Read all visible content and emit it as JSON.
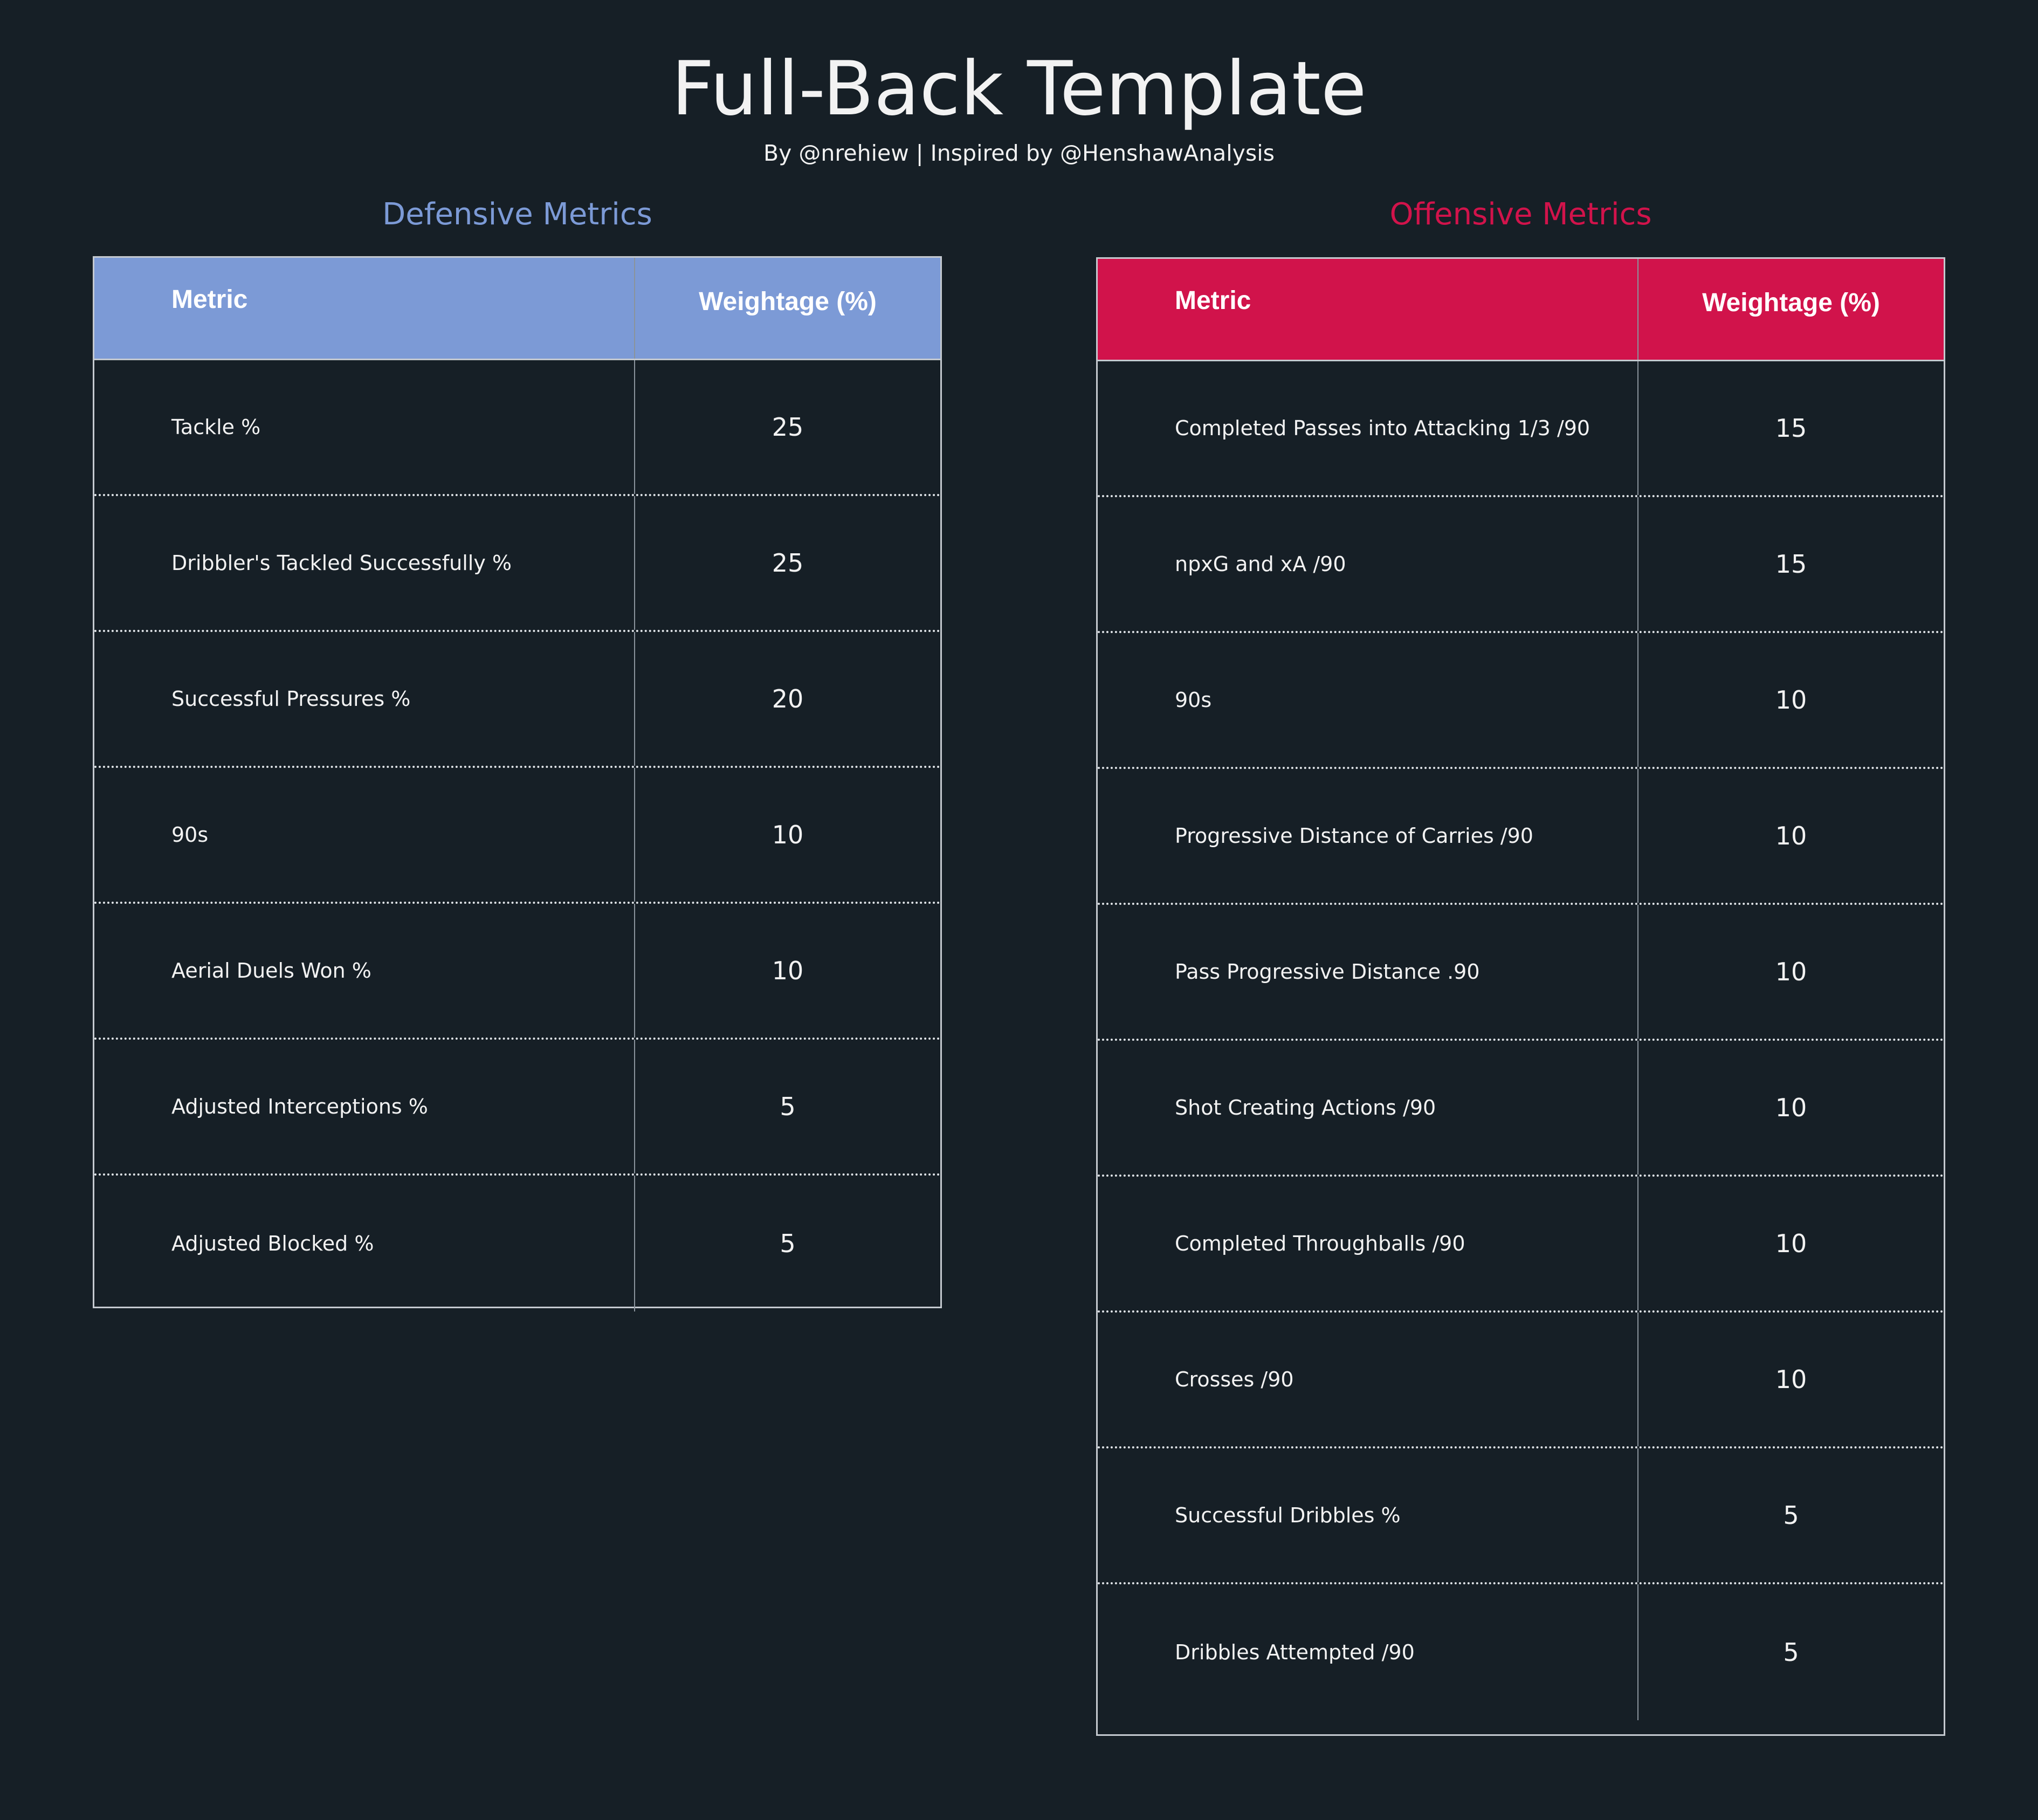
{
  "title": "Full-Back Template",
  "subtitle": "By @nrehiew | Inspired by @HenshawAnalysis",
  "colors": {
    "background": "#161f26",
    "defensive_accent": "#7c9ad6",
    "offensive_accent": "#d1134b",
    "text": "#f2f2f2"
  },
  "chart_data": [
    {
      "type": "table",
      "title": "Defensive Metrics",
      "columns": [
        "Metric",
        "Weightage (%)"
      ],
      "rows": [
        {
          "metric": "Tackle %",
          "weight": "25"
        },
        {
          "metric": "Dribbler's Tackled Successfully %",
          "weight": "25"
        },
        {
          "metric": "Successful Pressures %",
          "weight": "20"
        },
        {
          "metric": "90s",
          "weight": "10"
        },
        {
          "metric": "Aerial Duels Won %",
          "weight": "10"
        },
        {
          "metric": "Adjusted Interceptions %",
          "weight": "5"
        },
        {
          "metric": "Adjusted Blocked %",
          "weight": "5"
        }
      ]
    },
    {
      "type": "table",
      "title": "Offensive Metrics",
      "columns": [
        "Metric",
        "Weightage (%)"
      ],
      "rows": [
        {
          "metric": "Completed Passes into Attacking 1/3 /90",
          "weight": "15"
        },
        {
          "metric": "npxG and xA /90",
          "weight": "15"
        },
        {
          "metric": "90s",
          "weight": "10"
        },
        {
          "metric": "Progressive Distance of Carries /90",
          "weight": "10"
        },
        {
          "metric": "Pass Progressive Distance .90",
          "weight": "10"
        },
        {
          "metric": "Shot Creating Actions /90",
          "weight": "10"
        },
        {
          "metric": "Completed Throughballs /90",
          "weight": "10"
        },
        {
          "metric": "Crosses /90",
          "weight": "10"
        },
        {
          "metric": "Successful Dribbles %",
          "weight": "5"
        },
        {
          "metric": "Dribbles Attempted /90",
          "weight": "5"
        }
      ]
    }
  ]
}
